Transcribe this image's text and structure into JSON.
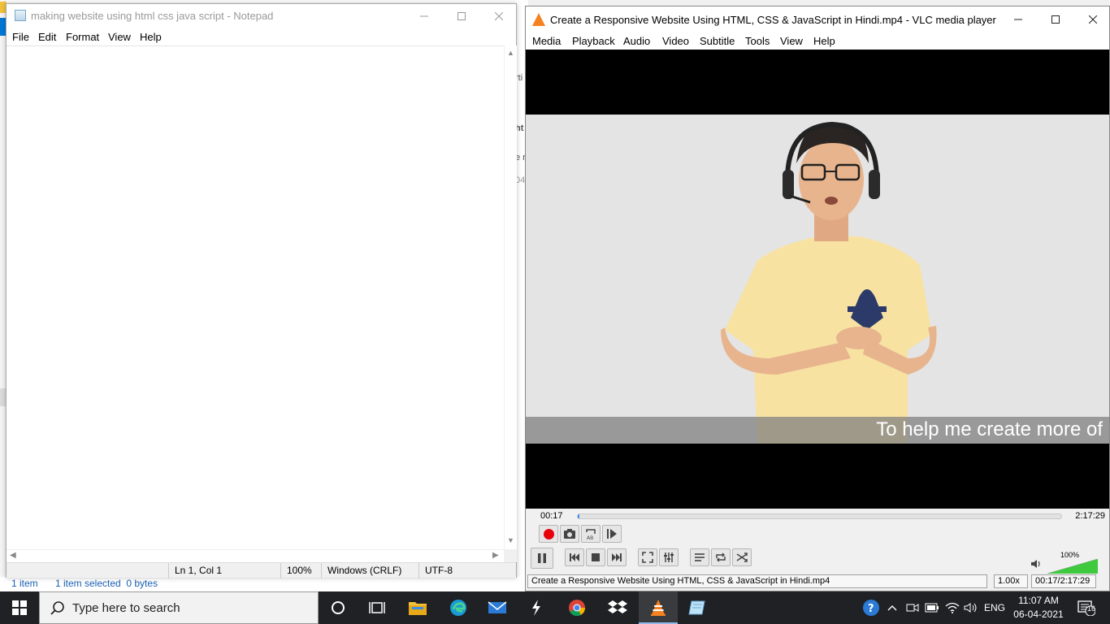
{
  "background_explorer": {
    "peek_texts": [
      "rti",
      "ht",
      "e r",
      "04"
    ],
    "status_items": "1 item",
    "status_selected": "1 item selected  0 bytes"
  },
  "notepad": {
    "title": "making website using html css java script - Notepad",
    "menu": [
      "File",
      "Edit",
      "Format",
      "View",
      "Help"
    ],
    "content": "",
    "status": {
      "position": "Ln 1, Col 1",
      "zoom": "100%",
      "line_endings": "Windows (CRLF)",
      "encoding": "UTF-8"
    }
  },
  "vlc": {
    "title": "Create a Responsive Website Using HTML, CSS & JavaScript in Hindi.mp4 - VLC media player",
    "menu": [
      "Media",
      "Playback",
      "Audio",
      "Video",
      "Subtitle",
      "Tools",
      "View",
      "Help"
    ],
    "subtitle": "To help me create more of",
    "elapsed": "00:17",
    "total": "2:17:29",
    "progress_fraction": 0.002,
    "volume_label": "100%",
    "volume_fraction": 1.0,
    "status_filename": "Create a Responsive Website Using HTML, CSS & JavaScript in Hindi.mp4",
    "status_speed": "1.00x",
    "status_time": "00:17/2:17:29"
  },
  "taskbar": {
    "search_placeholder": "Type here to search",
    "pinned_icons": [
      "cortana-icon",
      "task-view-icon",
      "file-explorer-icon",
      "edge-icon",
      "mail-icon",
      "app-bolt-icon",
      "chrome-icon",
      "dropbox-icon",
      "vlc-icon",
      "notepad-icon"
    ],
    "language": "ENG",
    "time": "11:07 AM",
    "date": "06-04-2021",
    "notification_count": "16"
  },
  "colors": {
    "vlc_accent": "#f58220",
    "seek_fill": "#3a8ee6",
    "volume_fill": "#3ec93e",
    "taskbar_bg": "#202125"
  }
}
